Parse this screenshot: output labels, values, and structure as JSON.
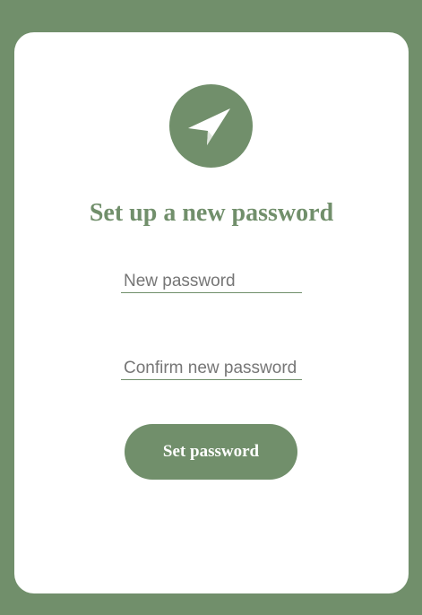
{
  "form": {
    "logo_icon": "paper-plane-icon",
    "title": "Set up a new password",
    "new_password_placeholder": "New password",
    "confirm_password_placeholder": "Confirm new password",
    "submit_label": "Set password"
  },
  "colors": {
    "accent": "#718f6b",
    "card": "#ffffff"
  }
}
